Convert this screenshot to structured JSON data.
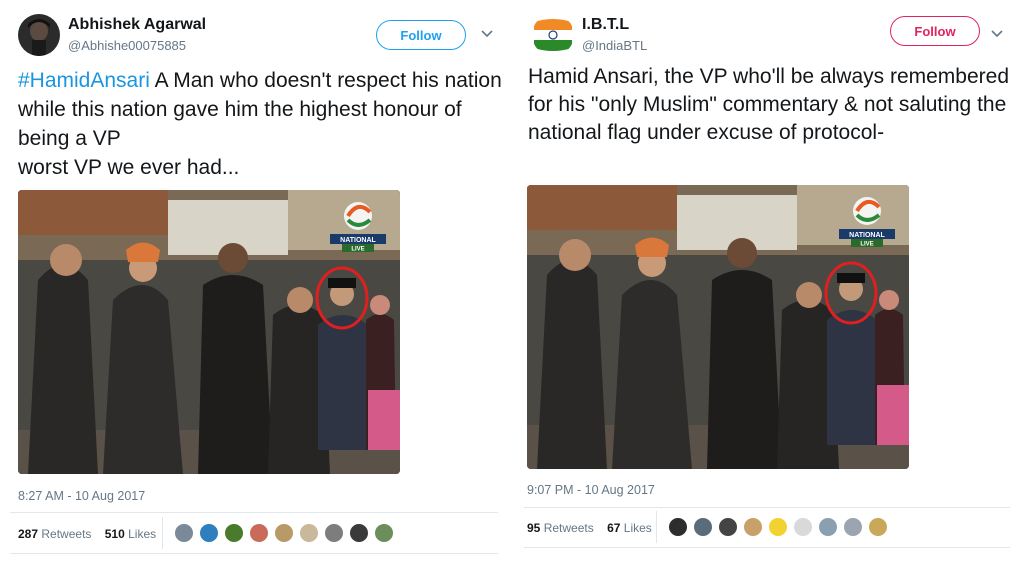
{
  "tweets": [
    {
      "author": {
        "name": "Abhishek Agarwal",
        "handle": "@Abhishe00075885"
      },
      "follow_label": "Follow",
      "hashtag": "#HamidAnsari",
      "text_after_hashtag": " A Man who doesn't respect his nation while this nation gave him the highest honour of being a VP",
      "text_line2": "worst VP we ever had...",
      "timestamp": "8:27 AM - 10 Aug 2017",
      "retweets": {
        "count": "287",
        "label": "Retweets"
      },
      "likes": {
        "count": "510",
        "label": "Likes"
      },
      "liker_colors": [
        "#7a8a99",
        "#2f7fbf",
        "#4a7a2c",
        "#c96a5a",
        "#b89a66",
        "#c9b89a",
        "#7d7d7d",
        "#3a3a3a",
        "#6b8e5a"
      ]
    },
    {
      "author": {
        "name": "I.B.T.L",
        "handle": "@IndiaBTL"
      },
      "follow_label": "Follow",
      "text": "Hamid Ansari, the VP who'll be always remembered for his \"only Muslim\" commentary & not saluting the national flag under excuse of protocol-",
      "timestamp": "9:07 PM - 10 Aug 2017",
      "retweets": {
        "count": "95",
        "label": "Retweets"
      },
      "likes": {
        "count": "67",
        "label": "Likes"
      },
      "liker_colors": [
        "#2d2d2d",
        "#5a6b7a",
        "#444444",
        "#c9a06a",
        "#f2d230",
        "#d9d9d9",
        "#8aa0b0",
        "#9aa5b0",
        "#c9a85a"
      ]
    }
  ],
  "photo": {
    "channel_badge": "NATIONAL",
    "channel_sub": "LIVE"
  },
  "colors": {
    "accent_blue": "#1da1f2",
    "follow_red": "#e0245e",
    "hashtag_blue": "#1b95e0",
    "muted": "#657786"
  }
}
